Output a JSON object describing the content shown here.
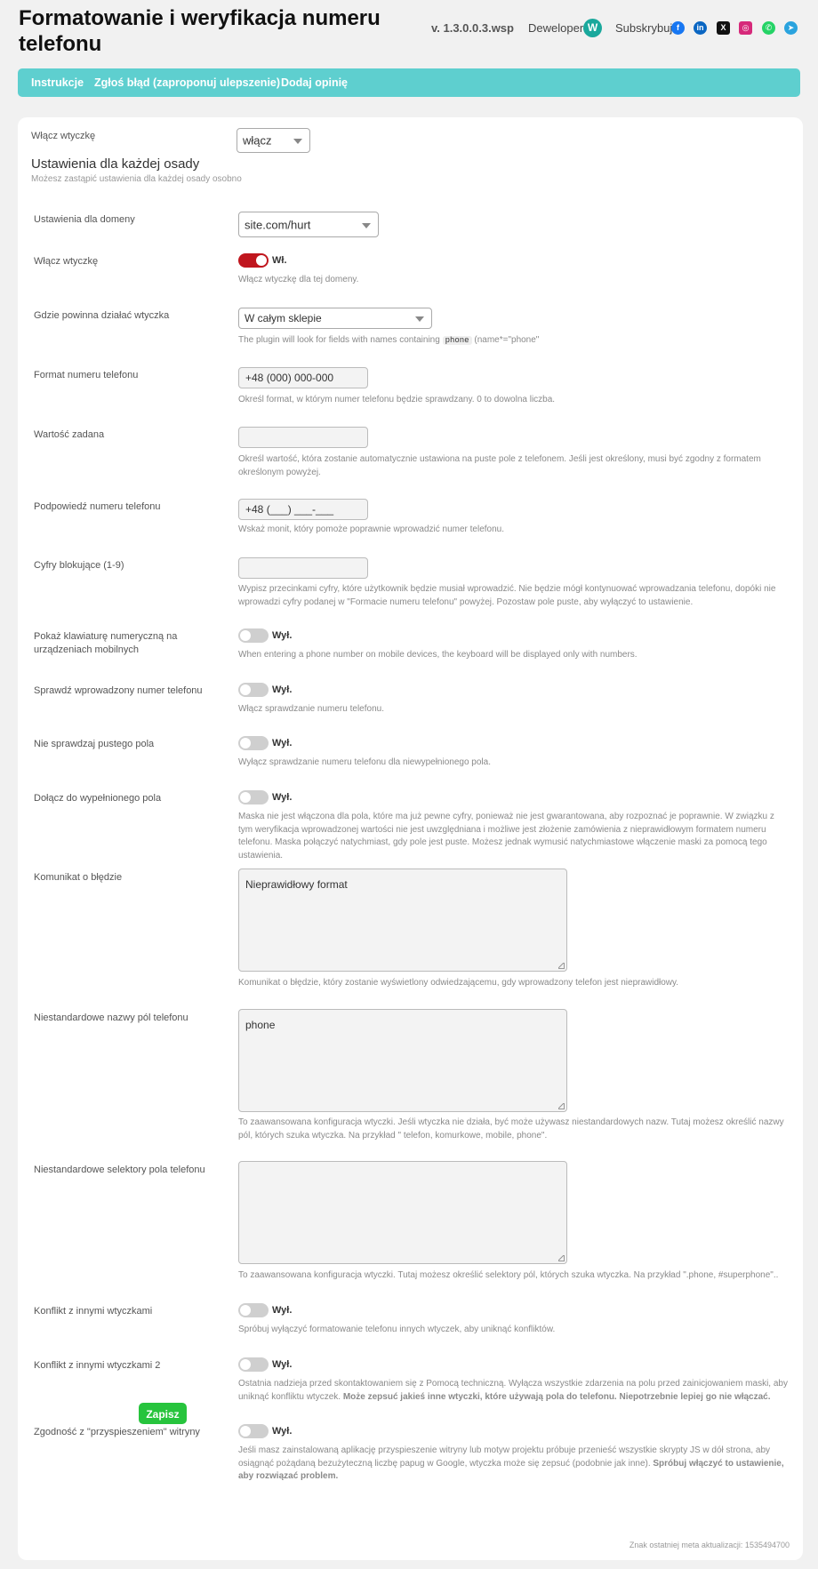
{
  "header": {
    "title": "Formatowanie i weryfikacja numeru telefonu",
    "version": "v. 1.3.0.0.3.wsp",
    "developer_label": "Deweloper:",
    "developer_logo": "W",
    "subscribe_label": "Subskrybuj:",
    "socials": [
      {
        "icon": "facebook-icon",
        "glyph": "f",
        "color": "#1877f2"
      },
      {
        "icon": "linkedin-icon",
        "glyph": "in",
        "color": "#0a66c2"
      },
      {
        "icon": "x-icon",
        "glyph": "X",
        "color": "#111111"
      },
      {
        "icon": "instagram-icon",
        "glyph": "◎",
        "color": "#d6297a"
      },
      {
        "icon": "whatsapp-icon",
        "glyph": "✆",
        "color": "#25d366"
      },
      {
        "icon": "telegram-icon",
        "glyph": "➤",
        "color": "#2aa3de"
      }
    ]
  },
  "nav": {
    "instructions": "Instrukcje",
    "report_bug": "Zgłoś błąd (zaproponuj ulepszenie)",
    "add_review": "Dodaj opinię"
  },
  "settings": {
    "enable_plugin_label": "Włącz wtyczkę",
    "enable_plugin_value": "włącz",
    "section_title": "Ustawienia dla każdej osady",
    "section_sub": "Możesz zastąpić ustawienia dla każdej osady osobno",
    "domain_label": "Ustawienia dla domeny",
    "domain_value": "site.com/hurt",
    "domain_enable_label": "Włącz wtyczkę",
    "domain_enable_state": "Wł.",
    "domain_enable_desc": "Włącz wtyczkę dla tej domeny.",
    "where_label": "Gdzie powinna działać wtyczka",
    "where_value": "W całym sklepie",
    "where_desc_pre": "The plugin will look for fields with names containing",
    "where_desc_code": "phone",
    "where_desc_post": "(name*=\"phone\"",
    "format_label": "Format numeru telefonu",
    "format_value": "+48 (000) 000-000",
    "format_desc": "Określ format, w którym numer telefonu będzie sprawdzany. 0 to dowolna liczba.",
    "default_label": "Wartość zadana",
    "default_value": "",
    "default_desc": "Określ wartość, która zostanie automatycznie ustawiona na puste pole z telefonem. Jeśli jest określony, musi być zgodny z formatem określonym powyżej.",
    "hint_label": "Podpowiedź numeru telefonu",
    "hint_value": "+48 (___) ___-___",
    "hint_desc": "Wskaż monit, który pomoże poprawnie wprowadzić numer telefonu.",
    "block_label": "Cyfry blokujące (1-9)",
    "block_value": "",
    "block_desc": "Wypisz przecinkami cyfry, które użytkownik będzie musiał wprowadzić. Nie będzie mógł kontynuować wprowadzania telefonu, dopóki nie wprowadzi cyfry podanej w \"Formacie numeru telefonu\" powyżej. Pozostaw pole puste, aby wyłączyć to ustawienie.",
    "numpad_label": "Pokaż klawiaturę numeryczną na urządzeniach mobilnych",
    "numpad_state": "Wył.",
    "numpad_desc": "When entering a phone number on mobile devices, the keyboard will be displayed only with numbers.",
    "validate_label": "Sprawdź wprowadzony numer telefonu",
    "validate_state": "Wył.",
    "validate_desc": "Włącz sprawdzanie numeru telefonu.",
    "empty_label": "Nie sprawdzaj pustego pola",
    "empty_state": "Wył.",
    "empty_desc": "Wyłącz sprawdzanie numeru telefonu dla niewypełnionego pola.",
    "filled_label": "Dołącz do wypełnionego pola",
    "filled_state": "Wył.",
    "filled_desc": "Maska nie jest włączona dla pola, które ma już pewne cyfry, ponieważ nie jest gwarantowana, aby rozpoznać je poprawnie. W związku z tym weryfikacja wprowadzonej wartości nie jest uwzględniana i możliwe jest złożenie zamówienia z nieprawidłowym formatem numeru telefonu. Maska połączyć natychmiast, gdy pole jest puste. Możesz jednak wymusić natychmiastowe włączenie maski za pomocą tego ustawienia.",
    "error_label": "Komunikat o błędzie",
    "error_value": "Nieprawidłowy format",
    "error_desc": "Komunikat o błędzie, który zostanie wyświetlony odwiedzającemu, gdy wprowadzony telefon jest nieprawidłowy.",
    "names_label": "Niestandardowe nazwy pól telefonu",
    "names_value": "phone",
    "names_desc": "To zaawansowana konfiguracja wtyczki. Jeśli wtyczka nie działa, być może używasz niestandardowych nazw. Tutaj możesz określić nazwy pól, których szuka wtyczka. Na przykład \" telefon, komurkowe, mobile, phone\".",
    "selectors_label": "Niestandardowe selektory pola telefonu",
    "selectors_value": "",
    "selectors_desc": "To zaawansowana konfiguracja wtyczki. Tutaj możesz określić selektory pól, których szuka wtyczka. Na przykład \".phone, #superphone\"..",
    "conflict_label": "Konflikt z innymi wtyczkami",
    "conflict_state": "Wył.",
    "conflict_desc": "Spróbuj wyłączyć formatowanie telefonu innych wtyczek, aby uniknąć konfliktów.",
    "conflict2_label": "Konflikt z innymi wtyczkami 2",
    "conflict2_state": "Wył.",
    "conflict2_desc": "Ostatnia nadzieja przed skontaktowaniem się z Pomocą techniczną. Wyłącza wszystkie zdarzenia na polu przed zainicjowaniem maski, aby uniknąć konfliktu wtyczek.",
    "conflict2_desc_bold": "Może zepsuć jakieś inne wtyczki, które używają pola do telefonu. Niepotrzebnie lepiej go nie włączać.",
    "speedup_label": "Zgodność z \"przyspieszeniem\" witryny",
    "speedup_state": "Wył.",
    "speedup_desc": "Jeśli masz zainstalowaną aplikację przyspieszenie witryny lub motyw projektu próbuje przenieść wszystkie skrypty JS w dół strona, aby osiągnąć pożądaną bezużyteczną liczbę papug w Google, wtyczka może się zepsuć (podobnie jak inne).",
    "speedup_desc_bold": "Spróbuj włączyć to ustawienie, aby rozwiązać problem.",
    "save_label": "Zapisz",
    "meta_label": "Znak ostatniej meta aktualizacji: 1535494700"
  }
}
